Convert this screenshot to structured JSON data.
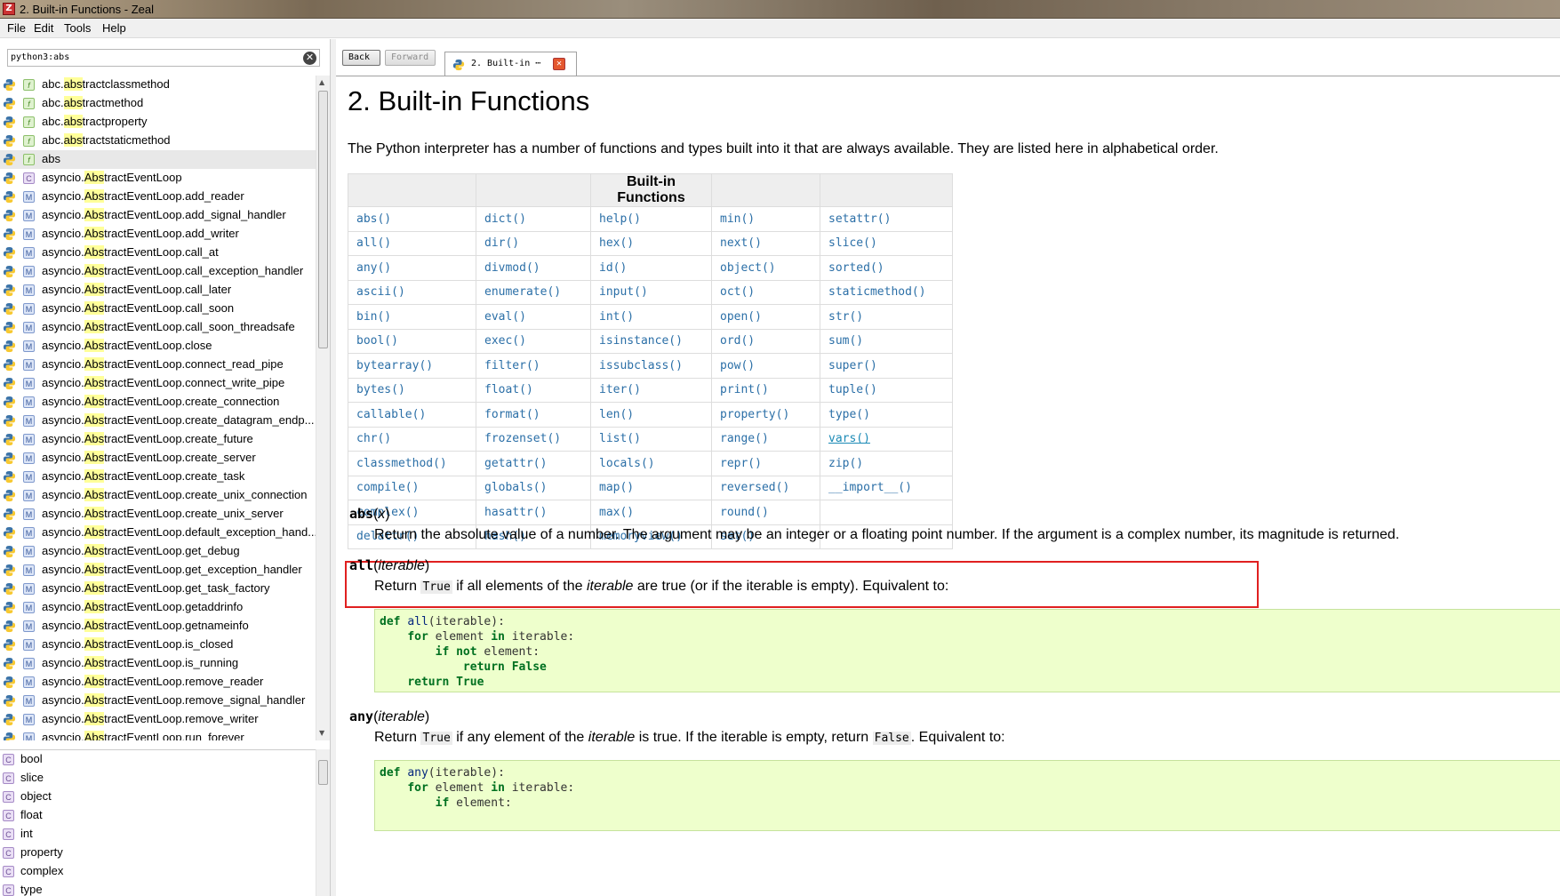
{
  "window": {
    "title": "2. Built-in Functions - Zeal"
  },
  "menu": [
    "File",
    "Edit",
    "Tools",
    "Help"
  ],
  "search": {
    "value": "python3:abs",
    "clear_icon": "clear-icon"
  },
  "results": [
    {
      "type": "f",
      "pre": "abc.",
      "hl": "abs",
      "post": "tractclassmethod"
    },
    {
      "type": "f",
      "pre": "abc.",
      "hl": "abs",
      "post": "tractmethod"
    },
    {
      "type": "f",
      "pre": "abc.",
      "hl": "abs",
      "post": "tractproperty"
    },
    {
      "type": "f",
      "pre": "abc.",
      "hl": "abs",
      "post": "tractstaticmethod"
    },
    {
      "type": "f",
      "pre": "",
      "hl": "",
      "post": "abs",
      "selected": true
    },
    {
      "type": "c",
      "pre": "asyncio.",
      "hl": "Abs",
      "post": "tractEventLoop"
    },
    {
      "type": "m",
      "pre": "asyncio.",
      "hl": "Abs",
      "post": "tractEventLoop.add_reader"
    },
    {
      "type": "m",
      "pre": "asyncio.",
      "hl": "Abs",
      "post": "tractEventLoop.add_signal_handler"
    },
    {
      "type": "m",
      "pre": "asyncio.",
      "hl": "Abs",
      "post": "tractEventLoop.add_writer"
    },
    {
      "type": "m",
      "pre": "asyncio.",
      "hl": "Abs",
      "post": "tractEventLoop.call_at"
    },
    {
      "type": "m",
      "pre": "asyncio.",
      "hl": "Abs",
      "post": "tractEventLoop.call_exception_handler"
    },
    {
      "type": "m",
      "pre": "asyncio.",
      "hl": "Abs",
      "post": "tractEventLoop.call_later"
    },
    {
      "type": "m",
      "pre": "asyncio.",
      "hl": "Abs",
      "post": "tractEventLoop.call_soon"
    },
    {
      "type": "m",
      "pre": "asyncio.",
      "hl": "Abs",
      "post": "tractEventLoop.call_soon_threadsafe"
    },
    {
      "type": "m",
      "pre": "asyncio.",
      "hl": "Abs",
      "post": "tractEventLoop.close"
    },
    {
      "type": "m",
      "pre": "asyncio.",
      "hl": "Abs",
      "post": "tractEventLoop.connect_read_pipe"
    },
    {
      "type": "m",
      "pre": "asyncio.",
      "hl": "Abs",
      "post": "tractEventLoop.connect_write_pipe"
    },
    {
      "type": "m",
      "pre": "asyncio.",
      "hl": "Abs",
      "post": "tractEventLoop.create_connection"
    },
    {
      "type": "m",
      "pre": "asyncio.",
      "hl": "Abs",
      "post": "tractEventLoop.create_datagram_endp..."
    },
    {
      "type": "m",
      "pre": "asyncio.",
      "hl": "Abs",
      "post": "tractEventLoop.create_future"
    },
    {
      "type": "m",
      "pre": "asyncio.",
      "hl": "Abs",
      "post": "tractEventLoop.create_server"
    },
    {
      "type": "m",
      "pre": "asyncio.",
      "hl": "Abs",
      "post": "tractEventLoop.create_task"
    },
    {
      "type": "m",
      "pre": "asyncio.",
      "hl": "Abs",
      "post": "tractEventLoop.create_unix_connection"
    },
    {
      "type": "m",
      "pre": "asyncio.",
      "hl": "Abs",
      "post": "tractEventLoop.create_unix_server"
    },
    {
      "type": "m",
      "pre": "asyncio.",
      "hl": "Abs",
      "post": "tractEventLoop.default_exception_hand..."
    },
    {
      "type": "m",
      "pre": "asyncio.",
      "hl": "Abs",
      "post": "tractEventLoop.get_debug"
    },
    {
      "type": "m",
      "pre": "asyncio.",
      "hl": "Abs",
      "post": "tractEventLoop.get_exception_handler"
    },
    {
      "type": "m",
      "pre": "asyncio.",
      "hl": "Abs",
      "post": "tractEventLoop.get_task_factory"
    },
    {
      "type": "m",
      "pre": "asyncio.",
      "hl": "Abs",
      "post": "tractEventLoop.getaddrinfo"
    },
    {
      "type": "m",
      "pre": "asyncio.",
      "hl": "Abs",
      "post": "tractEventLoop.getnameinfo"
    },
    {
      "type": "m",
      "pre": "asyncio.",
      "hl": "Abs",
      "post": "tractEventLoop.is_closed"
    },
    {
      "type": "m",
      "pre": "asyncio.",
      "hl": "Abs",
      "post": "tractEventLoop.is_running"
    },
    {
      "type": "m",
      "pre": "asyncio.",
      "hl": "Abs",
      "post": "tractEventLoop.remove_reader"
    },
    {
      "type": "m",
      "pre": "asyncio.",
      "hl": "Abs",
      "post": "tractEventLoop.remove_signal_handler"
    },
    {
      "type": "m",
      "pre": "asyncio.",
      "hl": "Abs",
      "post": "tractEventLoop.remove_writer"
    },
    {
      "type": "m",
      "pre": "asyncio.",
      "hl": "Abs",
      "post": "tractEventLoop.run_forever"
    }
  ],
  "toc": [
    "bool",
    "slice",
    "object",
    "float",
    "int",
    "property",
    "complex",
    "type"
  ],
  "nav": {
    "back": "Back",
    "forward": "Forward"
  },
  "tab": {
    "label": "2. Built-in ⋯",
    "close": "✕"
  },
  "doc": {
    "title": "2. Built-in Functions",
    "intro": "The Python interpreter has a number of functions and types built into it that are always available. They are listed here in alphabetical order.",
    "table_header": "Built-in Functions",
    "table": [
      [
        "abs()",
        "dict()",
        "help()",
        "min()",
        "setattr()"
      ],
      [
        "all()",
        "dir()",
        "hex()",
        "next()",
        "slice()"
      ],
      [
        "any()",
        "divmod()",
        "id()",
        "object()",
        "sorted()"
      ],
      [
        "ascii()",
        "enumerate()",
        "input()",
        "oct()",
        "staticmethod()"
      ],
      [
        "bin()",
        "eval()",
        "int()",
        "open()",
        "str()"
      ],
      [
        "bool()",
        "exec()",
        "isinstance()",
        "ord()",
        "sum()"
      ],
      [
        "bytearray()",
        "filter()",
        "issubclass()",
        "pow()",
        "super()"
      ],
      [
        "bytes()",
        "float()",
        "iter()",
        "print()",
        "tuple()"
      ],
      [
        "callable()",
        "format()",
        "len()",
        "property()",
        "type()"
      ],
      [
        "chr()",
        "frozenset()",
        "list()",
        "range()",
        "vars()"
      ],
      [
        "classmethod()",
        "getattr()",
        "locals()",
        "repr()",
        "zip()"
      ],
      [
        "compile()",
        "globals()",
        "map()",
        "reversed()",
        "__import__()"
      ],
      [
        "complex()",
        "hasattr()",
        "max()",
        "round()",
        ""
      ],
      [
        "delattr()",
        "hash()",
        "memoryview()",
        "set()",
        ""
      ]
    ],
    "abs": {
      "name": "abs",
      "arg": "x",
      "desc": "Return the absolute value of a number. The argument may be an integer or a floating point number. If the argument is a complex number, its magnitude is returned."
    },
    "all": {
      "name": "all",
      "arg": "iterable",
      "desc_a": "Return ",
      "code1": "True",
      "desc_b": " if all elements of the ",
      "em": "iterable",
      "desc_c": " are true (or if the iterable is empty). Equivalent to:"
    },
    "any": {
      "name": "any",
      "arg": "iterable",
      "desc_a": "Return ",
      "code1": "True",
      "desc_b": " if any element of the ",
      "em": "iterable",
      "desc_c": " is true. If the iterable is empty, return ",
      "code2": "False",
      "desc_d": ". Equivalent to:"
    }
  }
}
